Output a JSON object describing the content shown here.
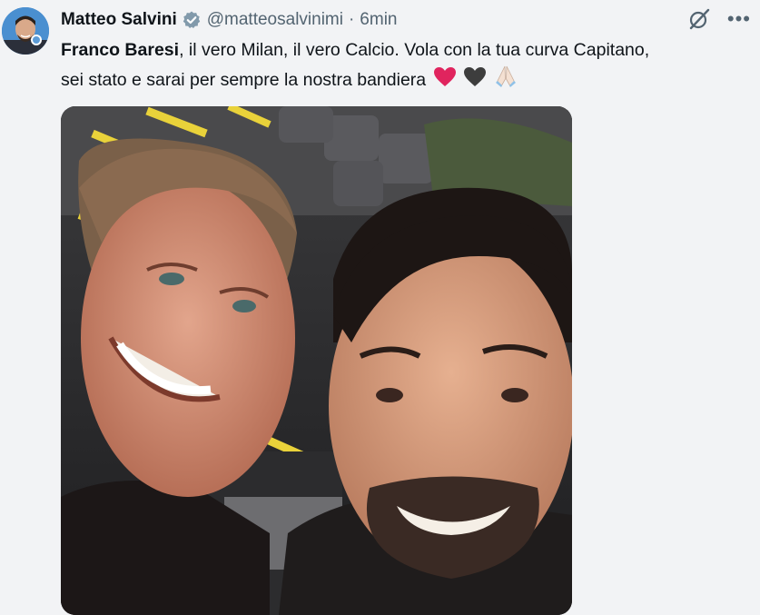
{
  "tweet": {
    "author": {
      "display_name": "Matteo Salvini",
      "handle": "@matteosalvinimi",
      "verified": true,
      "avatar_icon": "user-avatar"
    },
    "separator": "·",
    "timestamp": "6min",
    "text": {
      "bold_lead": "Franco Baresi",
      "line1_rest": ", il vero Milan, il vero Calcio. Vola con la tua curva Capitano,",
      "line2": "sei stato e sarai per sempre la nostra bandiera",
      "emojis": [
        "red-heart",
        "black-heart",
        "folded-hands"
      ]
    },
    "actions": {
      "grok_icon": "grok-icon",
      "more_icon": "more-options-icon"
    },
    "media": {
      "type": "photo",
      "description_icon": "selfie-photo"
    }
  },
  "colors": {
    "background": "#f2f3f5",
    "text_primary": "#0f1419",
    "text_secondary": "#536471",
    "verified_badge": "#829aab",
    "heart_red": "#e0245e",
    "heart_black": "#3d3d3d"
  }
}
